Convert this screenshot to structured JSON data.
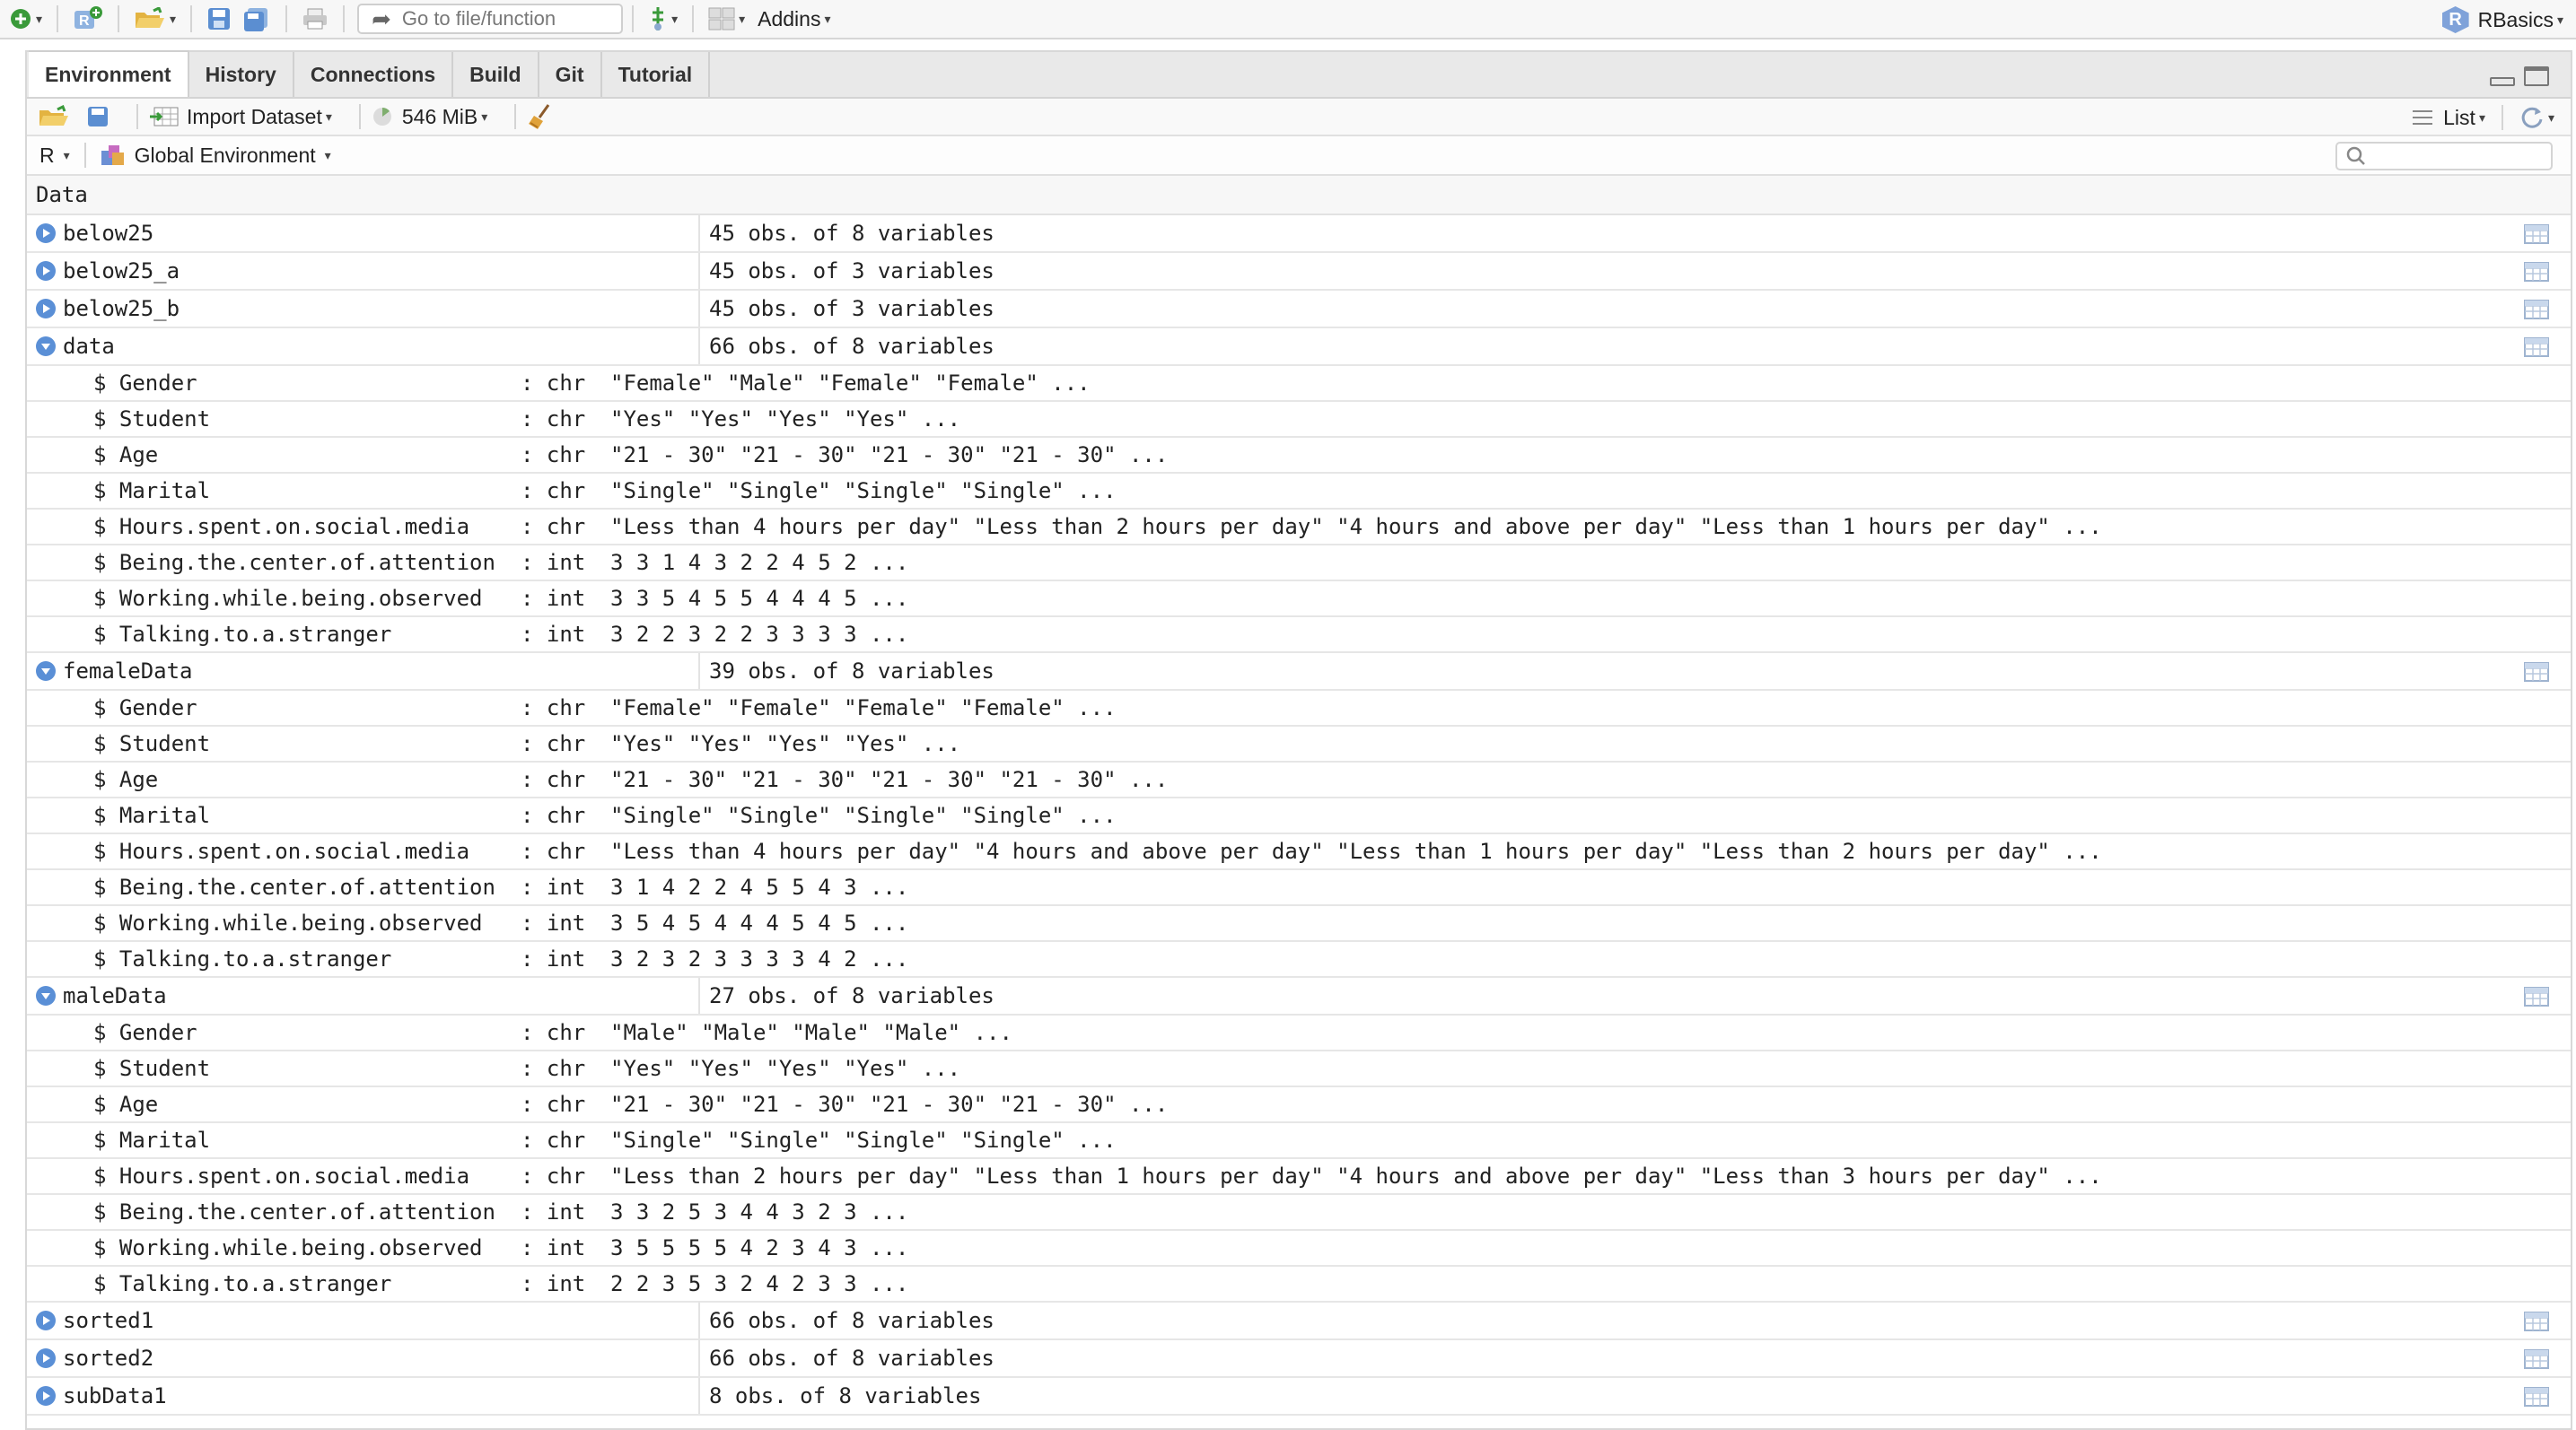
{
  "toolbar": {
    "goto_placeholder": "Go to file/function",
    "addins_label": "Addins",
    "project_name": "RBasics",
    "project_icon_letter": "R"
  },
  "tabs": [
    "Environment",
    "History",
    "Connections",
    "Build",
    "Git",
    "Tutorial"
  ],
  "env_toolbar": {
    "import_label": "Import Dataset",
    "memory_label": "546 MiB",
    "view_mode": "List"
  },
  "scope": {
    "language": "R",
    "environment": "Global Environment"
  },
  "section_title": "Data",
  "objects": [
    {
      "name": "below25",
      "summary": "45 obs. of 8 variables",
      "expanded": false,
      "fields": []
    },
    {
      "name": "below25_a",
      "summary": "45 obs. of 3 variables",
      "expanded": false,
      "fields": []
    },
    {
      "name": "below25_b",
      "summary": "45 obs. of 3 variables",
      "expanded": false,
      "fields": []
    },
    {
      "name": "data",
      "summary": "66 obs. of 8 variables",
      "expanded": true,
      "fields": [
        {
          "name": "$ Gender",
          "type": ": chr",
          "preview": "\"Female\" \"Male\" \"Female\" \"Female\" ..."
        },
        {
          "name": "$ Student",
          "type": ": chr",
          "preview": "\"Yes\" \"Yes\" \"Yes\" \"Yes\" ..."
        },
        {
          "name": "$ Age",
          "type": ": chr",
          "preview": "\"21 - 30\" \"21 - 30\" \"21 - 30\" \"21 - 30\" ..."
        },
        {
          "name": "$ Marital",
          "type": ": chr",
          "preview": "\"Single\" \"Single\" \"Single\" \"Single\" ..."
        },
        {
          "name": "$ Hours.spent.on.social.media",
          "type": ": chr",
          "preview": "\"Less than 4 hours per day\" \"Less than 2 hours per day\" \"4 hours and above per day\" \"Less than 1 hours per day\" ..."
        },
        {
          "name": "$ Being.the.center.of.attention",
          "type": ": int",
          "preview": "3 3 1 4 3 2 2 4 5 2 ..."
        },
        {
          "name": "$ Working.while.being.observed",
          "type": ": int",
          "preview": "3 3 5 4 5 5 4 4 4 5 ..."
        },
        {
          "name": "$ Talking.to.a.stranger",
          "type": ": int",
          "preview": "3 2 2 3 2 2 3 3 3 3 ..."
        }
      ]
    },
    {
      "name": "femaleData",
      "summary": "39 obs. of 8 variables",
      "expanded": true,
      "fields": [
        {
          "name": "$ Gender",
          "type": ": chr",
          "preview": "\"Female\" \"Female\" \"Female\" \"Female\" ..."
        },
        {
          "name": "$ Student",
          "type": ": chr",
          "preview": "\"Yes\" \"Yes\" \"Yes\" \"Yes\" ..."
        },
        {
          "name": "$ Age",
          "type": ": chr",
          "preview": "\"21 - 30\" \"21 - 30\" \"21 - 30\" \"21 - 30\" ..."
        },
        {
          "name": "$ Marital",
          "type": ": chr",
          "preview": "\"Single\" \"Single\" \"Single\" \"Single\" ..."
        },
        {
          "name": "$ Hours.spent.on.social.media",
          "type": ": chr",
          "preview": "\"Less than 4 hours per day\" \"4 hours and above per day\" \"Less than 1 hours per day\" \"Less than 2 hours per day\" ..."
        },
        {
          "name": "$ Being.the.center.of.attention",
          "type": ": int",
          "preview": "3 1 4 2 2 4 5 5 4 3 ..."
        },
        {
          "name": "$ Working.while.being.observed",
          "type": ": int",
          "preview": "3 5 4 5 4 4 4 5 4 5 ..."
        },
        {
          "name": "$ Talking.to.a.stranger",
          "type": ": int",
          "preview": "3 2 3 2 3 3 3 3 4 2 ..."
        }
      ]
    },
    {
      "name": "maleData",
      "summary": "27 obs. of 8 variables",
      "expanded": true,
      "fields": [
        {
          "name": "$ Gender",
          "type": ": chr",
          "preview": "\"Male\" \"Male\" \"Male\" \"Male\" ..."
        },
        {
          "name": "$ Student",
          "type": ": chr",
          "preview": "\"Yes\" \"Yes\" \"Yes\" \"Yes\" ..."
        },
        {
          "name": "$ Age",
          "type": ": chr",
          "preview": "\"21 - 30\" \"21 - 30\" \"21 - 30\" \"21 - 30\" ..."
        },
        {
          "name": "$ Marital",
          "type": ": chr",
          "preview": "\"Single\" \"Single\" \"Single\" \"Single\" ..."
        },
        {
          "name": "$ Hours.spent.on.social.media",
          "type": ": chr",
          "preview": "\"Less than 2 hours per day\" \"Less than 1 hours per day\" \"4 hours and above per day\" \"Less than 3 hours per day\" ..."
        },
        {
          "name": "$ Being.the.center.of.attention",
          "type": ": int",
          "preview": "3 3 2 5 3 4 4 3 2 3 ..."
        },
        {
          "name": "$ Working.while.being.observed",
          "type": ": int",
          "preview": "3 5 5 5 5 4 2 3 4 3 ..."
        },
        {
          "name": "$ Talking.to.a.stranger",
          "type": ": int",
          "preview": "2 2 3 5 3 2 4 2 3 3 ..."
        }
      ]
    },
    {
      "name": "sorted1",
      "summary": "66 obs. of 8 variables",
      "expanded": false,
      "fields": []
    },
    {
      "name": "sorted2",
      "summary": "66 obs. of 8 variables",
      "expanded": false,
      "fields": []
    },
    {
      "name": "subData1",
      "summary": "8 obs. of 8 variables",
      "expanded": false,
      "fields": []
    }
  ],
  "colors": {
    "expander": "#5a8fd6",
    "accent_green": "#3a9a3a"
  }
}
